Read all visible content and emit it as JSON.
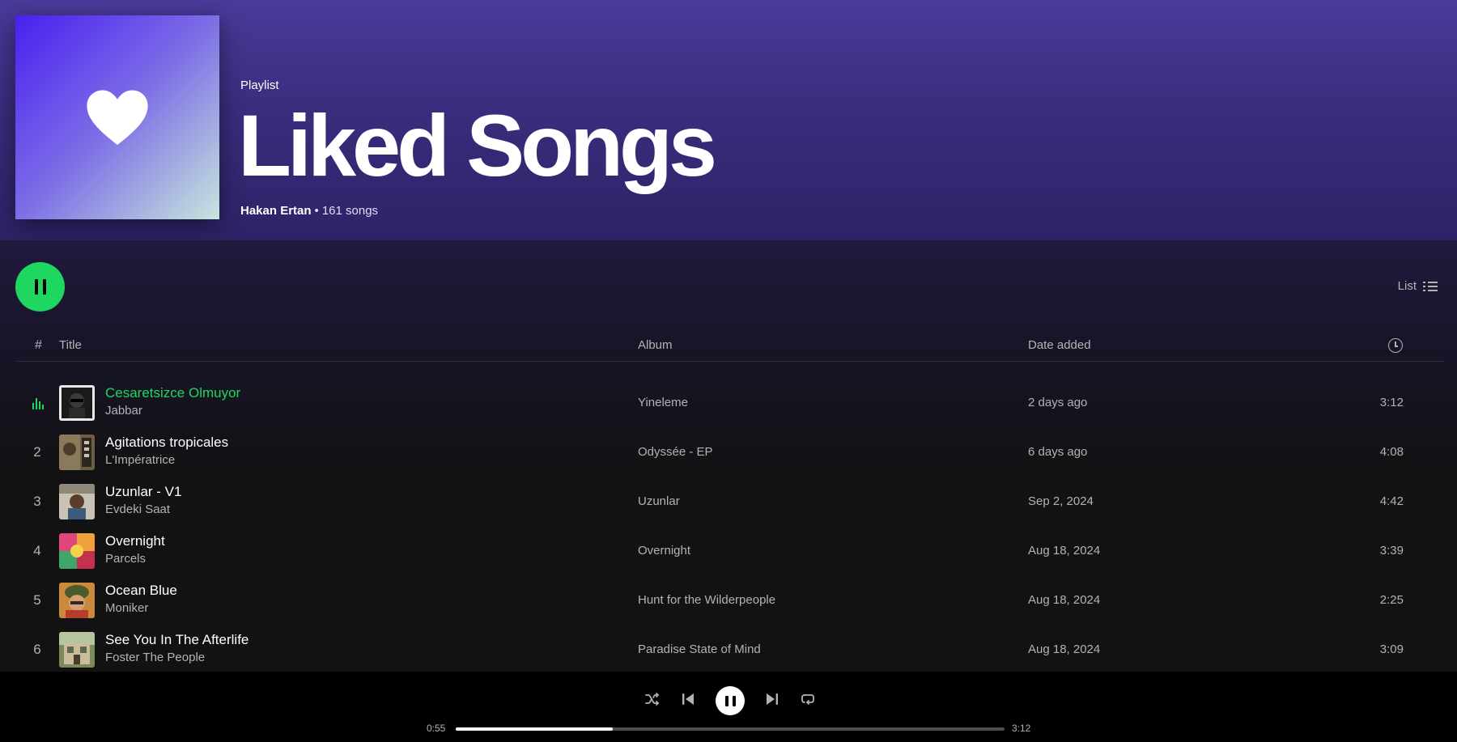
{
  "playlist": {
    "type_label": "Playlist",
    "title": "Liked Songs",
    "owner": "Hakan Ertan",
    "song_count": "161 songs"
  },
  "actions": {
    "view_mode": "List"
  },
  "columns": {
    "num": "#",
    "title": "Title",
    "album": "Album",
    "date_added": "Date added"
  },
  "tracks": [
    {
      "num": "1",
      "title": "Cesaretsizce Olmuyor",
      "artist": "Jabbar",
      "album": "Yineleme",
      "date_added": "2 days ago",
      "duration": "3:12",
      "playing": true
    },
    {
      "num": "2",
      "title": "Agitations tropicales",
      "artist": "L'Impératrice",
      "album": "Odyssée - EP",
      "date_added": "6 days ago",
      "duration": "4:08"
    },
    {
      "num": "3",
      "title": "Uzunlar - V1",
      "artist": "Evdeki Saat",
      "album": "Uzunlar",
      "date_added": "Sep 2, 2024",
      "duration": "4:42"
    },
    {
      "num": "4",
      "title": "Overnight",
      "artist": "Parcels",
      "album": "Overnight",
      "date_added": "Aug 18, 2024",
      "duration": "3:39"
    },
    {
      "num": "5",
      "title": "Ocean Blue",
      "artist": "Moniker",
      "album": "Hunt for the Wilderpeople",
      "date_added": "Aug 18, 2024",
      "duration": "2:25"
    },
    {
      "num": "6",
      "title": "See You In The Afterlife",
      "artist": "Foster The People",
      "album": "Paradise State of Mind",
      "date_added": "Aug 18, 2024",
      "duration": "3:09"
    }
  ],
  "player": {
    "elapsed": "0:55",
    "total": "3:12",
    "progress": 0.286
  },
  "colors": {
    "accent": "#1ed760",
    "header_bg": "#3e3186",
    "background": "#121212"
  },
  "icons": [
    "heart-icon",
    "pause-icon",
    "list-view-icon",
    "clock-icon",
    "equalizer-icon",
    "shuffle-icon",
    "previous-icon",
    "next-icon",
    "repeat-icon"
  ]
}
